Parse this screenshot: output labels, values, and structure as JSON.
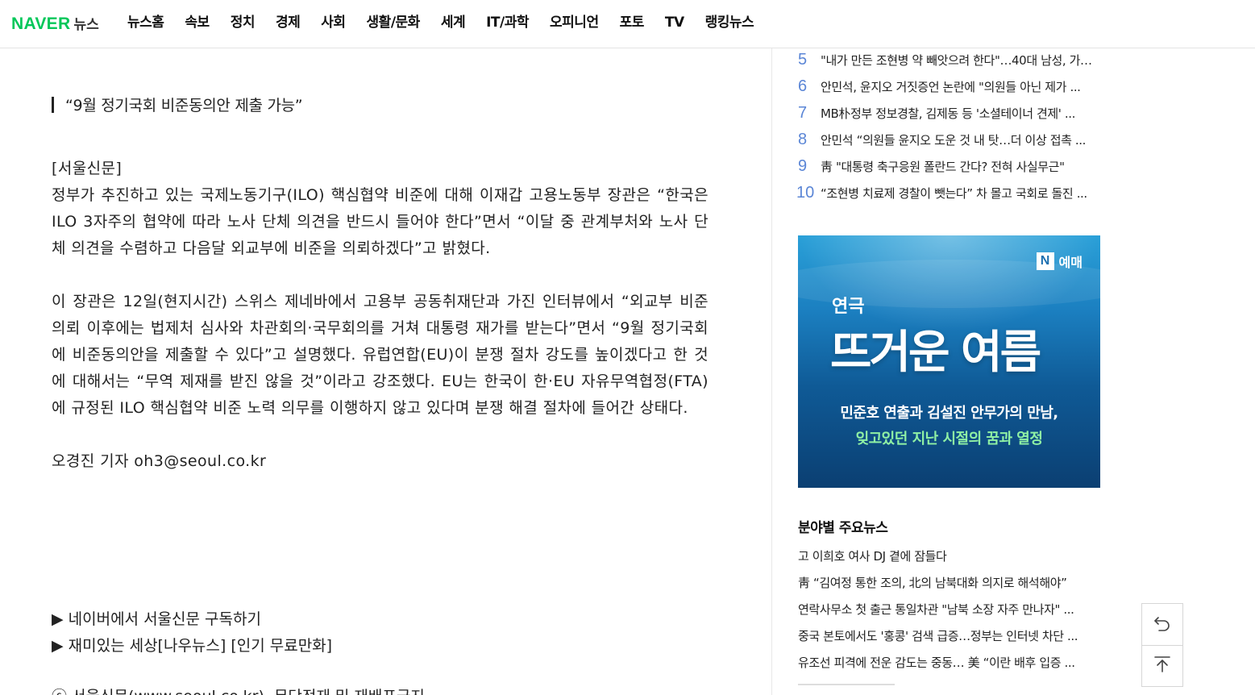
{
  "nav": {
    "logo_brand": "NAVER",
    "logo_service": "뉴스",
    "items": [
      "뉴스홈",
      "속보",
      "정치",
      "경제",
      "사회",
      "생활/문화",
      "세계",
      "IT/과학",
      "오피니언",
      "포토",
      "TV",
      "랭킹뉴스"
    ]
  },
  "article": {
    "subtitle": "“9월 정기국회 비준동의안 제출 가능”",
    "source": "[서울신문]",
    "para1": "정부가 추진하고 있는 국제노동기구(ILO) 핵심협약 비준에 대해 이재갑 고용노동부 장관은 “한국은 ILO 3자주의 협약에 따라 노사 단체 의견을 반드시 들어야 한다”면서 “이달 중 관계부처와 노사 단체 의견을 수렴하고 다음달 외교부에 비준을 의뢰하겠다”고 밝혔다.",
    "para2": "이 장관은 12일(현지시간) 스위스 제네바에서 고용부 공동취재단과 가진 인터뷰에서 “외교부 비준 의뢰 이후에는 법제처 심사와 차관회의·국무회의를 거쳐 대통령 재가를 받는다”면서 “9월 정기국회에 비준동의안을 제출할 수 있다”고 설명했다. 유럽연합(EU)이 분쟁 절차 강도를 높이겠다고 한 것에 대해서는 “무역 제재를 받진 않을 것”이라고 강조했다. EU는 한국이 한·EU 자유무역협정(FTA)에 규정된 ILO 핵심협약 비준 노력 의무를 이행하지 않고 있다며 분쟁 해결 절차에 들어간 상태다.",
    "byline": "오경진 기자 oh3@seoul.co.kr",
    "promo1": "네이버에서 서울신문 구독하기",
    "promo2": "재미있는 세상[나우뉴스] [인기 무료만화]",
    "promo_arrow": "▶",
    "cutoff": "ⓒ 서울신문(www.seoul.co.kr), 무단전재 및 재배포금지"
  },
  "ranking": [
    {
      "rank": "5",
      "title": "\"내가 만든 조현병 약 빼앗으려 한다\"…40대 남성, 가족 ..."
    },
    {
      "rank": "6",
      "title": "안민석, 윤지오 거짓증언 논란에 \"의원들 아닌 제가 ..."
    },
    {
      "rank": "7",
      "title": "MB朴정부 정보경찰, 김제동 등 '소셜테이너 견제' ..."
    },
    {
      "rank": "8",
      "title": "안민석 “의원들 윤지오 도운 것 내 탓…더 이상 접촉 ..."
    },
    {
      "rank": "9",
      "title": "靑 \"대통령 축구응원 폴란드 간다? 전혀 사실무근\""
    },
    {
      "rank": "10",
      "title": "“조현병 치료제 경찰이 뺏는다” 차 몰고 국회로 돌진 ..."
    }
  ],
  "ad": {
    "badge": "N",
    "brand": "예매",
    "small": "연극",
    "big": "뜨거운 여름",
    "line1": "민준호 연출과 김설진 안무가의 만남,",
    "line2": "잊고있던 지난 시절의 꿈과 열정"
  },
  "section": {
    "title": "분야별 주요뉴스",
    "items": [
      "고 이희호 여사 DJ 곁에 잠들다",
      "靑 “김여정 통한 조의, 北의 남북대화 의지로 해석해야”",
      "연락사무소 첫 출근 통일차관 \"남북 소장 자주 만나자\" ...",
      "중국 본토에서도 '홍콩' 검색 급증…정부는 인터넷 차단 ...",
      "유조선 피격에 전운 감도는 중동… 美 “이란 배후 입증 ..."
    ]
  },
  "colors": {
    "naver_green": "#03c75a",
    "rank_blue": "#5b86d6",
    "ad_highlight": "#8ff0a4"
  },
  "icons": {
    "fab_top": "undo-arrow-icon",
    "fab_bottom": "scroll-to-top-icon"
  }
}
